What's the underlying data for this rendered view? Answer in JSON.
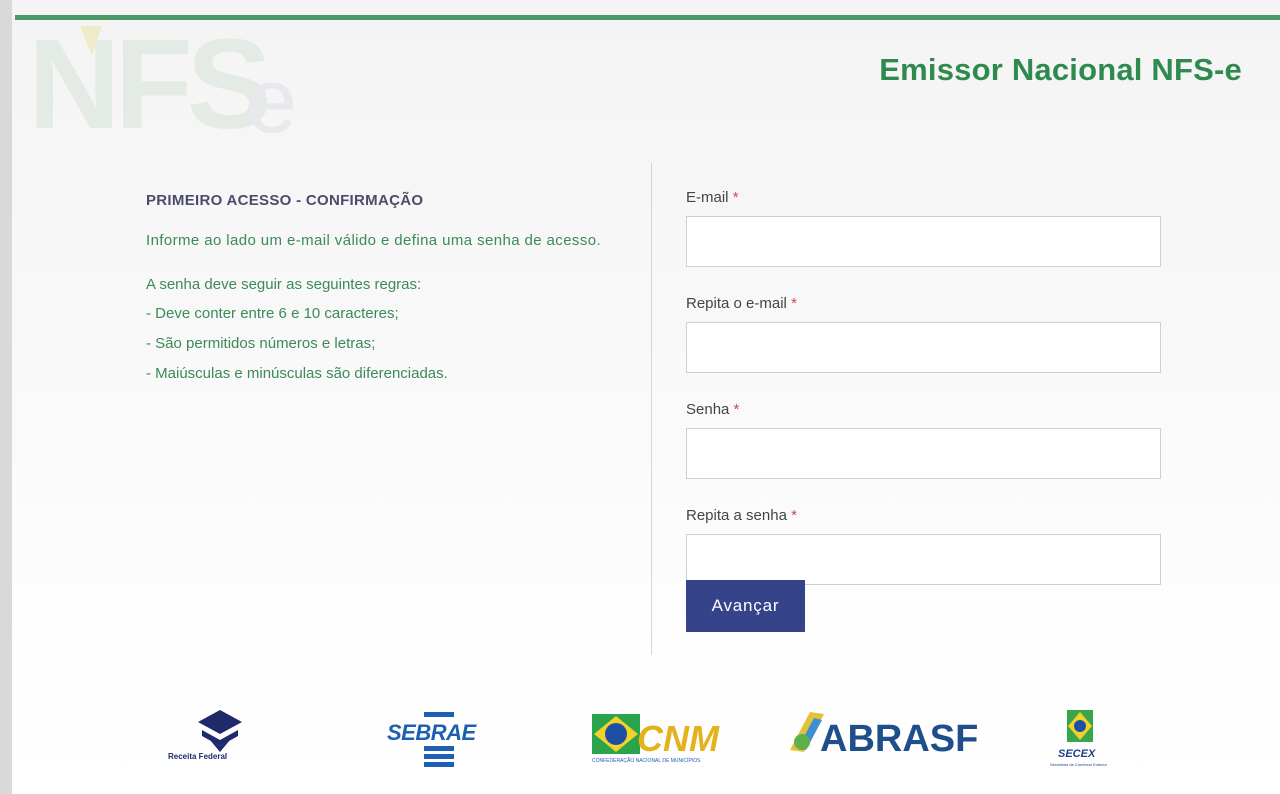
{
  "app": {
    "title": "Emissor Nacional NFS-e",
    "watermark_text": "NFSe"
  },
  "info": {
    "heading": "PRIMEIRO ACESSO - CONFIRMAÇÃO",
    "intro": "Informe ao lado um e-mail válido e defina uma senha de acesso.",
    "rules_title": "A senha deve seguir as seguintes regras:",
    "rules": [
      "- Deve conter entre 6 e 10 caracteres;",
      "- São permitidos números e letras;",
      "- Maiúsculas e minúsculas são diferenciadas."
    ]
  },
  "form": {
    "required_mark": "*",
    "fields": [
      {
        "label": "E-mail",
        "value": "",
        "placeholder": ""
      },
      {
        "label": "Repita o e-mail",
        "value": "",
        "placeholder": ""
      },
      {
        "label": "Senha",
        "value": "",
        "placeholder": ""
      },
      {
        "label": "Repita a senha",
        "value": "",
        "placeholder": ""
      }
    ],
    "submit_label": "Avançar"
  },
  "footer": {
    "logos": {
      "receita": "Receita Federal",
      "sebrae": "SEBRAE",
      "cnm": "CNM",
      "cnm_caption": "CONFEDERAÇÃO NACIONAL DE MUNICÍPIOS",
      "abrasf": "ABRASF",
      "secex": "SECEX",
      "secex_caption": "Secretaria de Comércio Exterior"
    }
  },
  "colors": {
    "accent_green": "#2f8a4e",
    "text_green": "#3c8a58",
    "button_blue": "#35438a",
    "required_red": "#c94b4b"
  }
}
